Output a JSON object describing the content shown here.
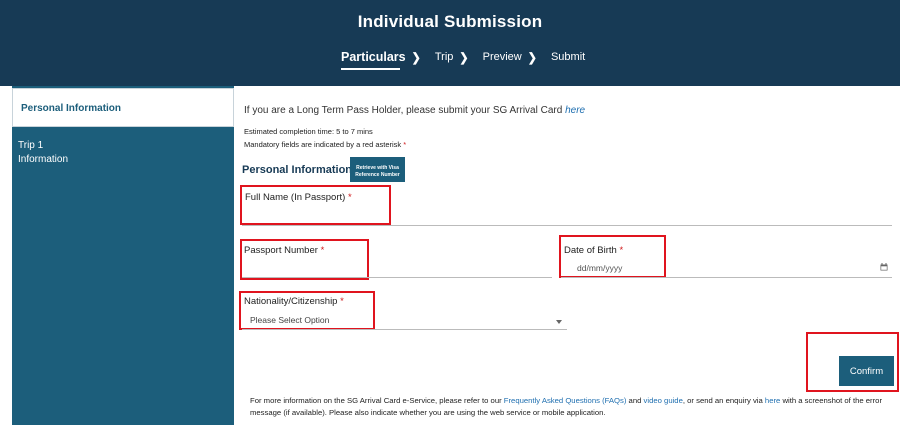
{
  "header": {
    "title": "Individual Submission",
    "steps": [
      {
        "label": "Particulars"
      },
      {
        "label": "Trip"
      },
      {
        "label": "Preview"
      },
      {
        "label": "Submit"
      }
    ]
  },
  "sidebar": {
    "items": [
      {
        "label": "Personal Information"
      },
      {
        "label_line1": "Trip 1",
        "label_line2": "Information"
      }
    ]
  },
  "main": {
    "ltph_text": "If you are a Long Term Pass Holder, please submit your SG Arrival Card ",
    "ltph_link": "here",
    "completion_time": "Estimated completion time: 5 to 7 mins",
    "mandatory_note": "Mandatory fields are indicated by a red asterisk ",
    "asterisk": "*",
    "section_title": "Personal Information",
    "retrieve_line1": "Retrieve with Visa",
    "retrieve_line2": "Reference Number",
    "fields": {
      "full_name_label": "Full Name (In Passport) ",
      "passport_label": "Passport Number ",
      "dob_label": "Date of Birth ",
      "dob_placeholder": "dd/mm/yyyy",
      "nationality_label": "Nationality/Citizenship ",
      "nationality_value": "Please Select Option"
    },
    "confirm_label": "Confirm",
    "footer": {
      "t1": "For more information on the SG Arrival Card e-Service, please refer to our ",
      "faq_link": "Frequently Asked Questions (FAQs)",
      "t2": " and ",
      "video_link": "video guide",
      "t3": ", or send an enquiry via ",
      "here_link": "here",
      "t4": " with a screenshot of the error message (if available). Please also indicate whether you are using the web service or mobile application."
    }
  },
  "colors": {
    "header_bg": "#173a55",
    "sidebar_bg": "#1c5e7b",
    "highlight": "#e0141e",
    "link": "#1f6fb0"
  }
}
